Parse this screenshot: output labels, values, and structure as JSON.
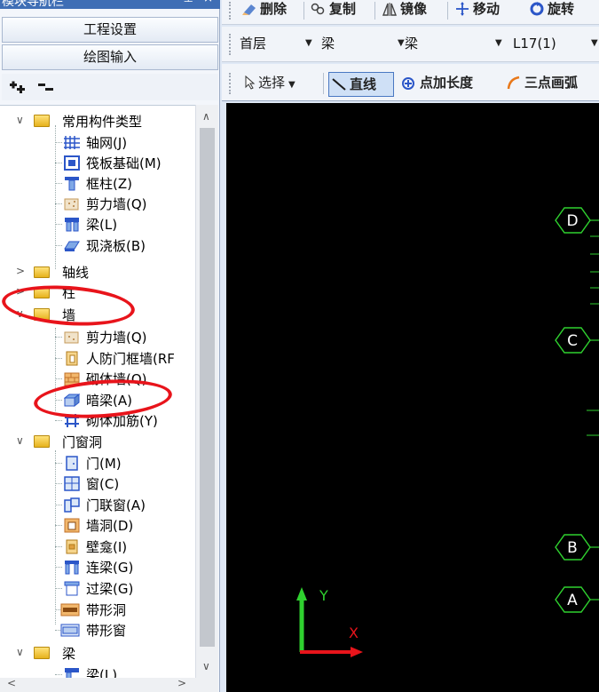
{
  "panel": {
    "title": "模块导航栏",
    "pin_glyph": "⊥",
    "close_glyph": "×",
    "btn_engineering": "工程设置",
    "btn_drawing_input": "绘图输入"
  },
  "tree": {
    "common_types": "常用构件类型",
    "common_axis": "轴网(J)",
    "common_raft": "筏板基础(M)",
    "common_frame_col": "框柱(Z)",
    "common_shear_wall": "剪力墙(Q)",
    "common_beam": "梁(L)",
    "common_slab": "现浇板(B)",
    "axis": "轴线",
    "column": "柱",
    "wall": "墙",
    "wall_shear": "剪力墙(Q)",
    "wall_civil_def": "人防门框墙(RF",
    "wall_masonry": "砌体墙(Q)",
    "wall_hidden_beam": "暗梁(A)",
    "wall_masonry_rebar": "砌体加筋(Y)",
    "openings": "门窗洞",
    "op_door": "门(M)",
    "op_window": "窗(C)",
    "op_door_window": "门联窗(A)",
    "op_wall_hole": "墙洞(D)",
    "op_niche": "壁龛(I)",
    "op_link_beam": "连梁(G)",
    "op_lintel": "过梁(G)",
    "op_strip_hole": "带形洞",
    "op_strip_window": "带形窗",
    "beam": "梁",
    "beam_child": "梁(L)"
  },
  "toolbar1": {
    "delete": "删除",
    "copy": "复制",
    "mirror": "镜像",
    "move": "移动",
    "rotate": "旋转"
  },
  "toolbar2": {
    "floor": "首层",
    "category": "梁",
    "type": "梁",
    "component": "L17(1)"
  },
  "toolbar3": {
    "select": "选择",
    "line": "直线",
    "point_length": "点加长度",
    "three_point_arc": "三点画弧"
  },
  "canvas": {
    "axis_labels": [
      "D",
      "C",
      "B",
      "A"
    ],
    "y_label": "Y",
    "x_label": "X"
  },
  "colors": {
    "annotation": "#e8141b",
    "axis_green": "#2fd12f",
    "canvas_bg": "#000000"
  }
}
